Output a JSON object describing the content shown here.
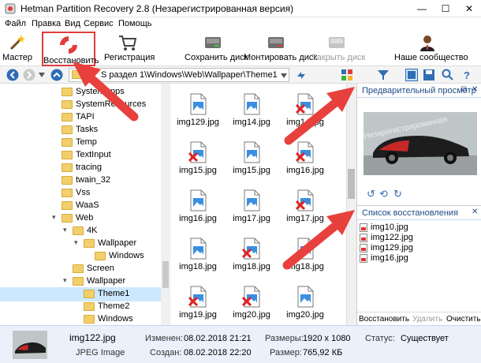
{
  "window": {
    "title": "Hetman Partition Recovery 2.8 (Незарегистрированная версия)",
    "minimize": "—",
    "maximize": "☐",
    "close": "✕"
  },
  "menu": [
    "Файл",
    "Правка",
    "Вид",
    "Сервис",
    "Помощь"
  ],
  "toolbar": {
    "wizard": "Мастер",
    "restore": "Восстановить",
    "register": "Регистрация",
    "save_disk": "Сохранить диск",
    "mount_disk": "Монтировать диск",
    "close_disk": "Закрыть диск",
    "community": "Наше сообщество",
    "restore_highlight_color": "#e23b3b"
  },
  "address": {
    "path": "S раздел 1\\Windows\\Web\\Wallpaper\\Theme1"
  },
  "tree": [
    {
      "label": "SystemApps",
      "indent": 0
    },
    {
      "label": "SystemResources",
      "indent": 0
    },
    {
      "label": "TAPI",
      "indent": 0
    },
    {
      "label": "Tasks",
      "indent": 0
    },
    {
      "label": "Temp",
      "indent": 0
    },
    {
      "label": "TextInput",
      "indent": 0
    },
    {
      "label": "tracing",
      "indent": 0
    },
    {
      "label": "twain_32",
      "indent": 0
    },
    {
      "label": "Vss",
      "indent": 0
    },
    {
      "label": "WaaS",
      "indent": 0
    },
    {
      "label": "Web",
      "indent": 0
    },
    {
      "label": "4K",
      "indent": 1
    },
    {
      "label": "Wallpaper",
      "indent": 2
    },
    {
      "label": "Windows",
      "indent": 3
    },
    {
      "label": "Screen",
      "indent": 1
    },
    {
      "label": "Wallpaper",
      "indent": 1
    },
    {
      "label": "Theme1",
      "indent": 2,
      "selected": true
    },
    {
      "label": "Theme2",
      "indent": 2
    },
    {
      "label": "Windows",
      "indent": 2
    }
  ],
  "files": [
    {
      "name": "img129.jpg",
      "deleted": false
    },
    {
      "name": "img14.jpg",
      "deleted": false
    },
    {
      "name": "img14.jpg",
      "deleted": true
    },
    {
      "name": "img15.jpg",
      "deleted": true
    },
    {
      "name": "img15.jpg",
      "deleted": false
    },
    {
      "name": "img16.jpg",
      "deleted": true
    },
    {
      "name": "img16.jpg",
      "deleted": false
    },
    {
      "name": "img17.jpg",
      "deleted": false
    },
    {
      "name": "img17.jpg",
      "deleted": true
    },
    {
      "name": "img18.jpg",
      "deleted": false
    },
    {
      "name": "img18.jpg",
      "deleted": true
    },
    {
      "name": "img18.jpg",
      "deleted": false
    },
    {
      "name": "img19.jpg",
      "deleted": true
    },
    {
      "name": "img20.jpg",
      "deleted": true
    },
    {
      "name": "img20.jpg",
      "deleted": false
    }
  ],
  "preview": {
    "title": "Предварительный просмотр",
    "watermark": "Незарегистрированная"
  },
  "restore_list": {
    "title": "Список восстановления",
    "items": [
      "img10.jpg",
      "img122.jpg",
      "img129.jpg",
      "img16.jpg"
    ],
    "restore_button": "Восстановить",
    "delete_button": "Удалить",
    "clear_button": "Очистить с"
  },
  "status": {
    "filename": "img122.jpg",
    "filetype": "JPEG Image",
    "modified_label": "Изменен:",
    "modified_value": "08.02.2018 21:21",
    "created_label": "Создан:",
    "created_value": "08.02.2018 22:20",
    "size_label": "Размеры:",
    "size_value": "1920 x 1080",
    "bytes_label": "Размер:",
    "bytes_value": "765,92 КБ",
    "state_label": "Статус:",
    "state_value": "Существует"
  },
  "colors": {
    "arrow": "#e8403c",
    "accent": "#1e4b85"
  }
}
